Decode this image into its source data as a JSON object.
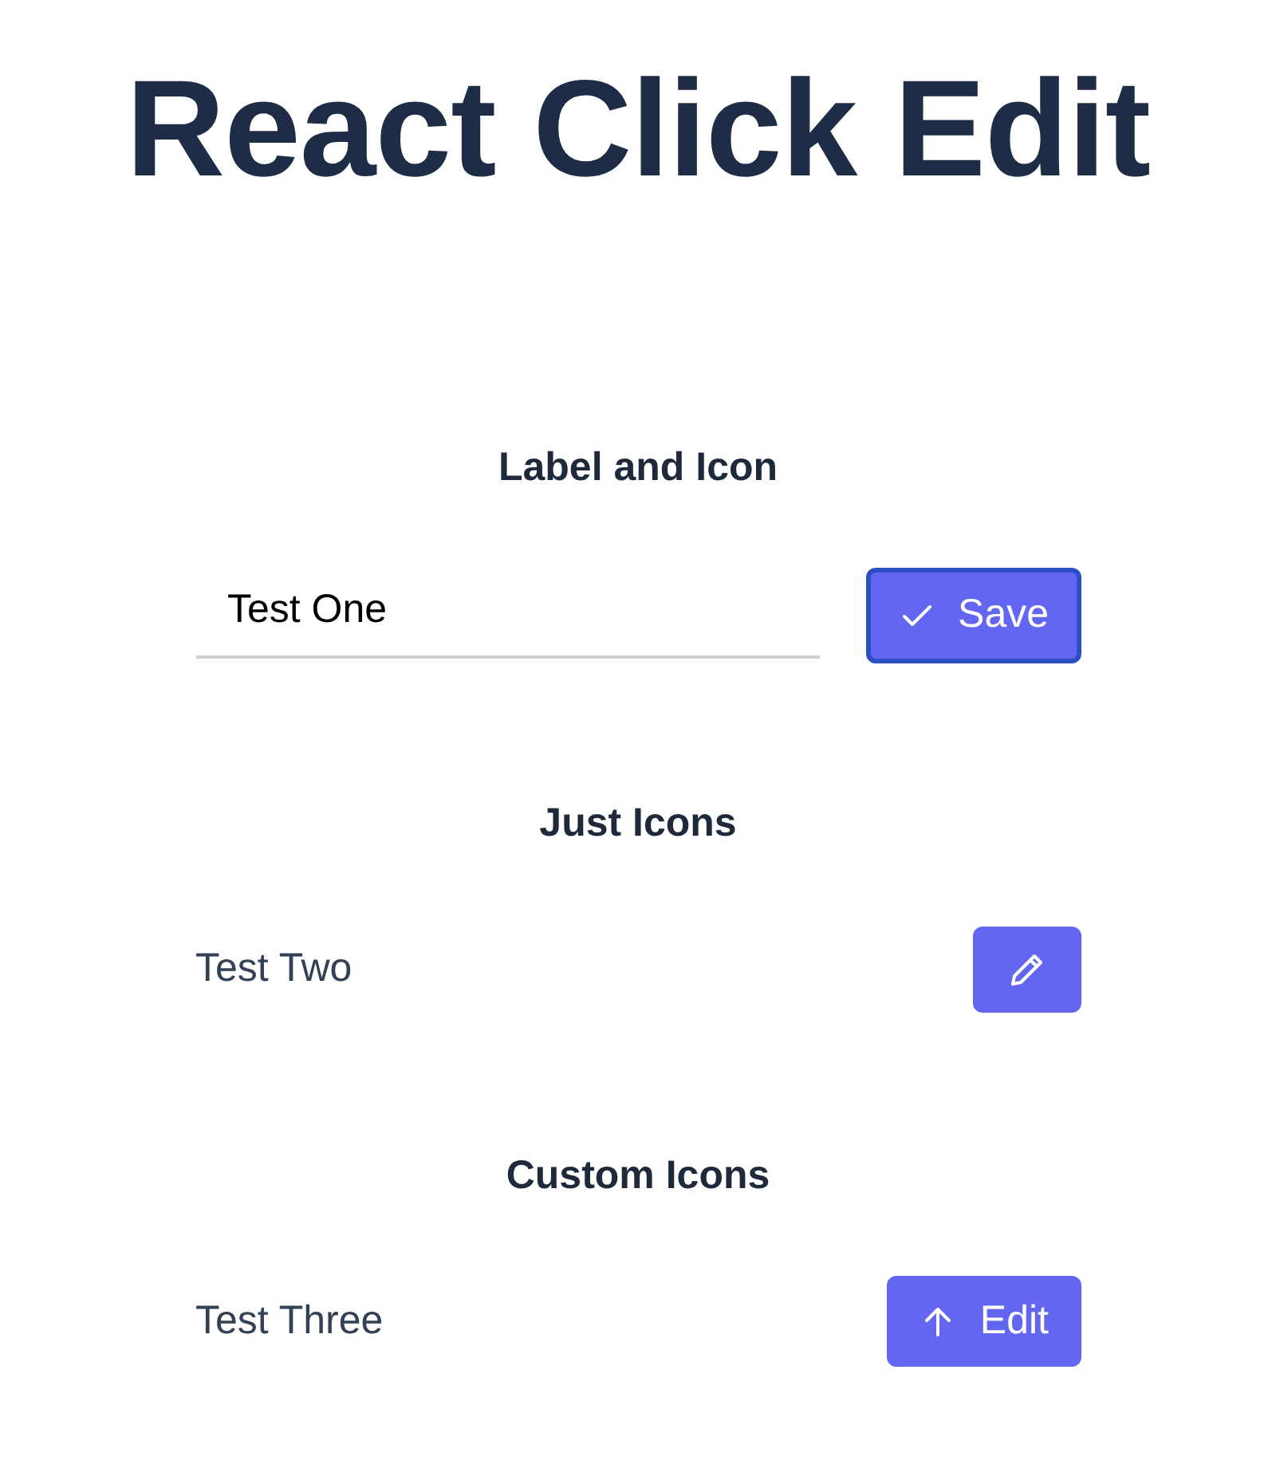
{
  "title": "React Click Edit",
  "sections": [
    {
      "heading": "Label and Icon",
      "kind": "editing",
      "value": "Test One",
      "button": {
        "label": "Save",
        "kind": "check",
        "focused": true
      }
    },
    {
      "heading": "Just Icons",
      "kind": "display",
      "text": "Test Two",
      "button": {
        "kind": "pencil",
        "focused": false
      }
    },
    {
      "heading": "Custom Icons",
      "kind": "display",
      "text": "Test Three",
      "button": {
        "label": "Edit",
        "kind": "arrow",
        "focused": false
      }
    }
  ]
}
